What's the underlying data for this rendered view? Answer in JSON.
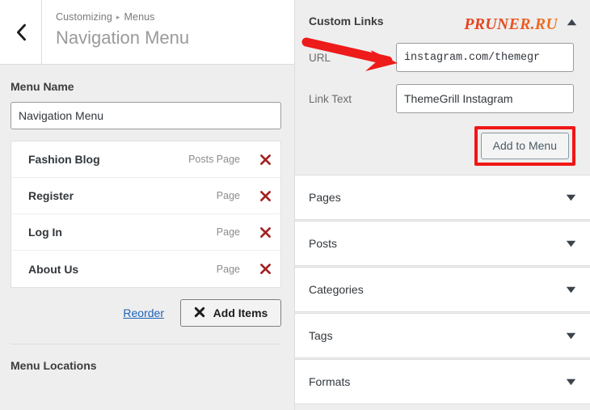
{
  "left_panel": {
    "back_button": {
      "icon": "chevron-left-icon"
    },
    "breadcrumb": {
      "root": "Customizing",
      "separator": "▸",
      "current": "Menus"
    },
    "title": "Navigation Menu",
    "menu_name": {
      "label": "Menu Name",
      "value": "Navigation Menu",
      "placeholder": "Menu Name"
    },
    "menu_items": [
      {
        "title": "Fashion Blog",
        "type": "Posts Page",
        "remove_icon": "close-x-icon"
      },
      {
        "title": "Register",
        "type": "Page",
        "remove_icon": "close-x-icon"
      },
      {
        "title": "Log In",
        "type": "Page",
        "remove_icon": "close-x-icon"
      },
      {
        "title": "About Us",
        "type": "Page",
        "remove_icon": "close-x-icon"
      }
    ],
    "actions": {
      "reorder_label": "Reorder",
      "add_items_label": "Add Items",
      "add_items_icon": "x-mark-icon"
    },
    "menu_locations_title": "Menu Locations"
  },
  "right_panel": {
    "custom_links": {
      "title": "Custom Links",
      "collapse_icon": "chevron-up-icon",
      "fields": [
        {
          "label": "URL",
          "value": "instagram.com/themegr",
          "placeholder": "https://",
          "mono": true
        },
        {
          "label": "Link Text",
          "value": "ThemeGrill Instagram",
          "placeholder": "Menu Item",
          "mono": false
        }
      ],
      "add_to_menu_label": "Add to Menu"
    },
    "accordions": [
      {
        "label": "Pages",
        "chevron": "chevron-down-icon"
      },
      {
        "label": "Posts",
        "chevron": "chevron-down-icon"
      },
      {
        "label": "Categories",
        "chevron": "chevron-down-icon"
      },
      {
        "label": "Tags",
        "chevron": "chevron-down-icon"
      },
      {
        "label": "Formats",
        "chevron": "chevron-down-icon"
      }
    ]
  },
  "watermark": {
    "text": "PRUNER.RU"
  },
  "annotations": {
    "arrow": {
      "name": "red-arrow-annotation",
      "color": "#ee1b1b",
      "points_to": "URL input field"
    },
    "highlight_box": {
      "name": "red-highlight-box",
      "color": "#f01717",
      "surrounds": "Add to Menu button"
    }
  },
  "colors": {
    "panel_background": "#eeeeee",
    "card_background": "#ffffff",
    "border": "#dddddd",
    "text_primary": "#32373c",
    "text_muted": "#8c8c8c",
    "link_blue": "#1c62b9",
    "remove_red": "#a42222",
    "annotation_red": "#ee1b1b"
  }
}
